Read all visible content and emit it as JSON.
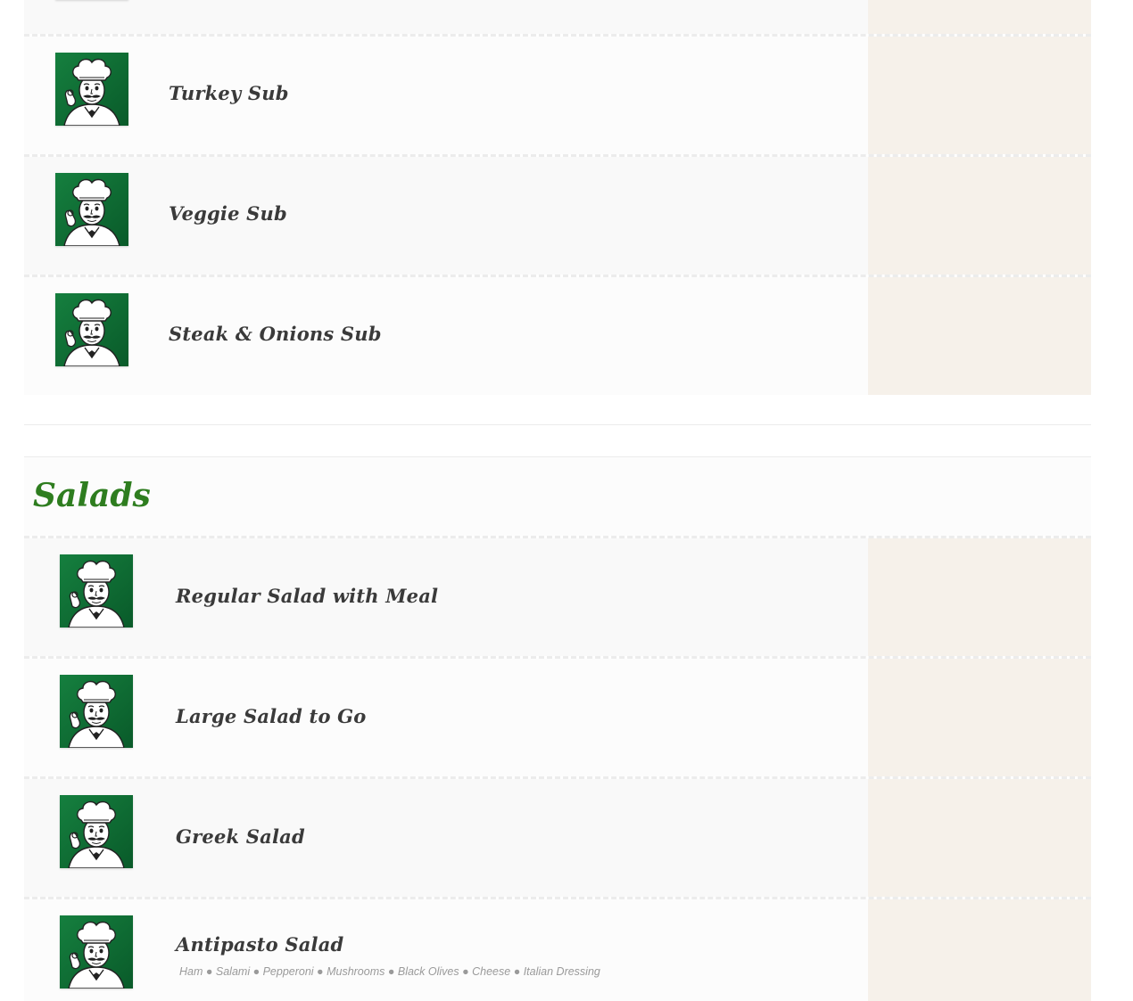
{
  "subs": {
    "items": [
      {
        "name": "Turkey Sub",
        "thumb_icon": "chef-logo-icon"
      },
      {
        "name": "Veggie Sub",
        "thumb_icon": "chef-logo-icon"
      },
      {
        "name": "Steak & Onions Sub",
        "thumb_icon": "chef-logo-icon"
      }
    ]
  },
  "salads": {
    "title": "Salads",
    "items": [
      {
        "name": "Regular Salad with Meal",
        "description": "",
        "thumb_icon": "chef-logo-icon"
      },
      {
        "name": "Large Salad to Go",
        "description": "",
        "thumb_icon": "chef-logo-icon"
      },
      {
        "name": "Greek Salad",
        "description": "",
        "thumb_icon": "chef-logo-icon"
      },
      {
        "name": "Antipasto Salad",
        "description": "Ham ● Salami ● Pepperoni ● Mushrooms ● Black Olives ● Cheese ● Italian Dressing",
        "thumb_icon": "chef-logo-icon"
      }
    ]
  },
  "colors": {
    "section_title": "#2e7d1f",
    "thumb_green": "#0f7a3a",
    "price_column": "#f6f1ea",
    "item_name": "#3a3a3a",
    "description": "#9a9a9a"
  }
}
